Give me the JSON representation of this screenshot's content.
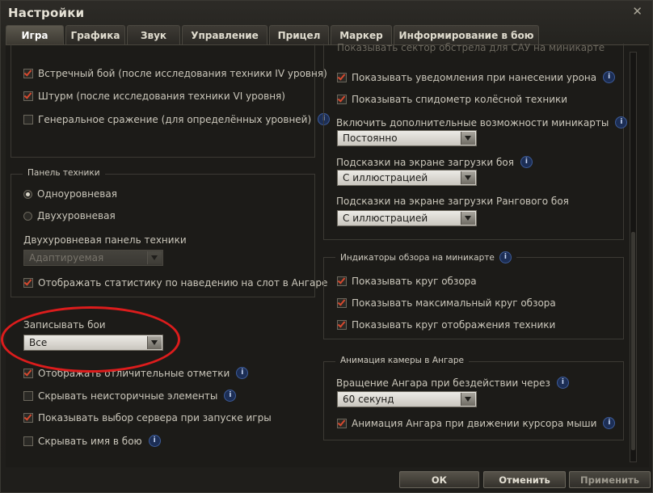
{
  "window": {
    "title": "Настройки",
    "close_symbol": "✕"
  },
  "tabs": [
    "Игра",
    "Графика",
    "Звук",
    "Управление",
    "Прицел",
    "Маркер",
    "Информирование в бою"
  ],
  "left": {
    "battle_modes": [
      {
        "label": "Встречный бой (после исследования техники IV уровня)",
        "checked": true,
        "info": false
      },
      {
        "label": "Штурм (после исследования техники VI уровня)",
        "checked": true,
        "info": false
      },
      {
        "label": "Генеральное сражение (для определённых уровней)",
        "checked": false,
        "info": true
      }
    ],
    "carousel": {
      "title": "Панель техники",
      "options": [
        {
          "label": "Одноуровневая",
          "selected": true
        },
        {
          "label": "Двухуровневая",
          "selected": false
        }
      ],
      "double_label": "Двухуровневая панель техники",
      "double_value": "Адаптируемая",
      "stats_label": "Отображать статистику по наведению на слот в Ангаре"
    },
    "replays": {
      "label": "Записывать бои",
      "value": "Все"
    },
    "extra": [
      {
        "label": "Отображать отличительные отметки",
        "checked": true,
        "info": true
      },
      {
        "label": "Скрывать неисторичные элементы",
        "checked": false,
        "info": true
      },
      {
        "label": "Показывать выбор сервера при запуске игры",
        "checked": true,
        "info": false
      },
      {
        "label": "Скрывать имя в бою",
        "checked": false,
        "info": true
      }
    ]
  },
  "right": {
    "cut_text": "Показывать сектор обстрела для САУ на миникарте",
    "top_checks": [
      {
        "label": "Показывать уведомления при нанесении урона",
        "checked": true,
        "info": true
      },
      {
        "label": "Показывать спидометр колёсной техники",
        "checked": true,
        "info": false
      }
    ],
    "minimap": {
      "label": "Включить дополнительные возможности миникарты",
      "value": "Постоянно"
    },
    "loading_tips": {
      "label": "Подсказки на экране загрузки боя",
      "value": "С иллюстрацией"
    },
    "ranked_tips": {
      "label": "Подсказки на экране загрузки Рангового боя",
      "value": "С иллюстрацией"
    },
    "view_indicators": {
      "title": "Индикаторы обзора на миникарте",
      "checks": [
        {
          "label": "Показывать круг обзора",
          "checked": true
        },
        {
          "label": "Показывать максимальный круг обзора",
          "checked": true
        },
        {
          "label": "Показывать круг отображения техники",
          "checked": true
        }
      ]
    },
    "hangar_camera": {
      "title": "Анимация камеры в Ангаре",
      "idle_label": "Вращение Ангара при бездействии через",
      "idle_value": "60 секунд",
      "mouse_label": "Анимация Ангара при движении курсора мыши",
      "mouse_checked": true
    }
  },
  "buttons": {
    "ok": "ОК",
    "cancel": "Отменить",
    "apply": "Применить"
  },
  "info_symbol": "i",
  "colors": {
    "annotation": "#dc1c1c",
    "check": "#d6492e",
    "info": "#1c2e55"
  }
}
